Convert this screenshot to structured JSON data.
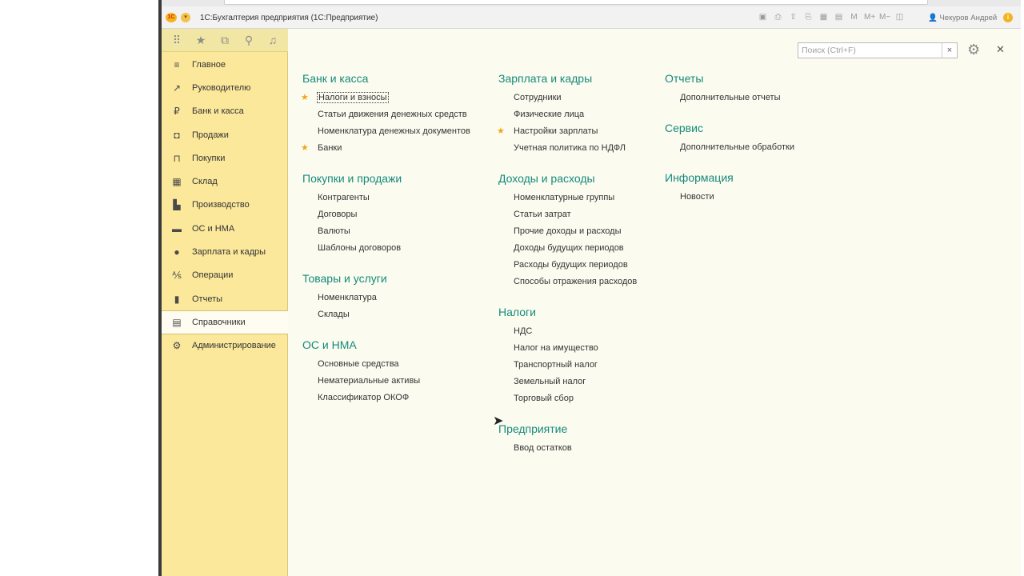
{
  "titlebar": {
    "app_title": "1С:Бухгалтерия предприятия  (1С:Предприятие)",
    "user": "Чекуров Андрей"
  },
  "sidebar": {
    "items": [
      {
        "label": "Главное",
        "icon": "list-icon",
        "glyph": "≡"
      },
      {
        "label": "Руководителю",
        "icon": "trend-icon",
        "glyph": "↗"
      },
      {
        "label": "Банк и касса",
        "icon": "ruble-icon",
        "glyph": "₽"
      },
      {
        "label": "Продажи",
        "icon": "bag-icon",
        "glyph": "◘"
      },
      {
        "label": "Покупки",
        "icon": "cart-icon",
        "glyph": "⊓"
      },
      {
        "label": "Склад",
        "icon": "warehouse-icon",
        "glyph": "▦"
      },
      {
        "label": "Производство",
        "icon": "factory-icon",
        "glyph": "▙"
      },
      {
        "label": "ОС и НМА",
        "icon": "truck-icon",
        "glyph": "▬"
      },
      {
        "label": "Зарплата и кадры",
        "icon": "person-icon",
        "glyph": "●"
      },
      {
        "label": "Операции",
        "icon": "dt-kt-icon",
        "glyph": "⅍"
      },
      {
        "label": "Отчеты",
        "icon": "bar-chart-icon",
        "glyph": "▮"
      },
      {
        "label": "Справочники",
        "icon": "books-icon",
        "glyph": "▤"
      },
      {
        "label": "Администрирование",
        "icon": "gear-icon",
        "glyph": "⚙"
      }
    ],
    "active_index": 11
  },
  "search": {
    "placeholder": "Поиск (Ctrl+F)",
    "value": ""
  },
  "columns": [
    {
      "sections": [
        {
          "title": "Банк и касса",
          "links": [
            {
              "label": "Налоги и взносы",
              "starred": true,
              "focus": true
            },
            {
              "label": "Статьи движения денежных средств",
              "starred": false
            },
            {
              "label": "Номенклатура денежных документов",
              "starred": false
            },
            {
              "label": "Банки",
              "starred": true
            }
          ]
        },
        {
          "title": "Покупки и продажи",
          "links": [
            {
              "label": "Контрагенты",
              "starred": false
            },
            {
              "label": "Договоры",
              "starred": false
            },
            {
              "label": "Валюты",
              "starred": false
            },
            {
              "label": "Шаблоны договоров",
              "starred": false
            }
          ]
        },
        {
          "title": "Товары и услуги",
          "links": [
            {
              "label": "Номенклатура",
              "starred": false
            },
            {
              "label": "Склады",
              "starred": false
            }
          ]
        },
        {
          "title": "ОС и НМА",
          "links": [
            {
              "label": "Основные средства",
              "starred": false
            },
            {
              "label": "Нематериальные активы",
              "starred": false
            },
            {
              "label": "Классификатор ОКОФ",
              "starred": false
            }
          ]
        }
      ]
    },
    {
      "sections": [
        {
          "title": "Зарплата и кадры",
          "links": [
            {
              "label": "Сотрудники",
              "starred": false
            },
            {
              "label": "Физические лица",
              "starred": false
            },
            {
              "label": "Настройки зарплаты",
              "starred": true
            },
            {
              "label": "Учетная политика по НДФЛ",
              "starred": false
            }
          ]
        },
        {
          "title": "Доходы и расходы",
          "links": [
            {
              "label": "Номенклатурные группы",
              "starred": false
            },
            {
              "label": "Статьи затрат",
              "starred": false
            },
            {
              "label": "Прочие доходы и расходы",
              "starred": false
            },
            {
              "label": "Доходы будущих периодов",
              "starred": false
            },
            {
              "label": "Расходы будущих периодов",
              "starred": false
            },
            {
              "label": "Способы отражения расходов",
              "starred": false
            }
          ]
        },
        {
          "title": "Налоги",
          "links": [
            {
              "label": "НДС",
              "starred": false
            },
            {
              "label": "Налог на имущество",
              "starred": false
            },
            {
              "label": "Транспортный налог",
              "starred": false
            },
            {
              "label": "Земельный налог",
              "starred": false
            },
            {
              "label": "Торговый сбор",
              "starred": false
            }
          ]
        },
        {
          "title": "Предприятие",
          "links": [
            {
              "label": "Ввод остатков",
              "starred": false
            }
          ]
        }
      ]
    },
    {
      "sections": [
        {
          "title": "Отчеты",
          "links": [
            {
              "label": "Дополнительные отчеты",
              "starred": false
            }
          ]
        },
        {
          "title": "Сервис",
          "links": [
            {
              "label": "Дополнительные обработки",
              "starred": false
            }
          ]
        },
        {
          "title": "Информация",
          "links": [
            {
              "label": "Новости",
              "starred": false
            }
          ]
        }
      ]
    }
  ],
  "colors": {
    "section_title": "#168a7a",
    "sidebar_bg": "#fbe89b",
    "star": "#f2a619"
  }
}
